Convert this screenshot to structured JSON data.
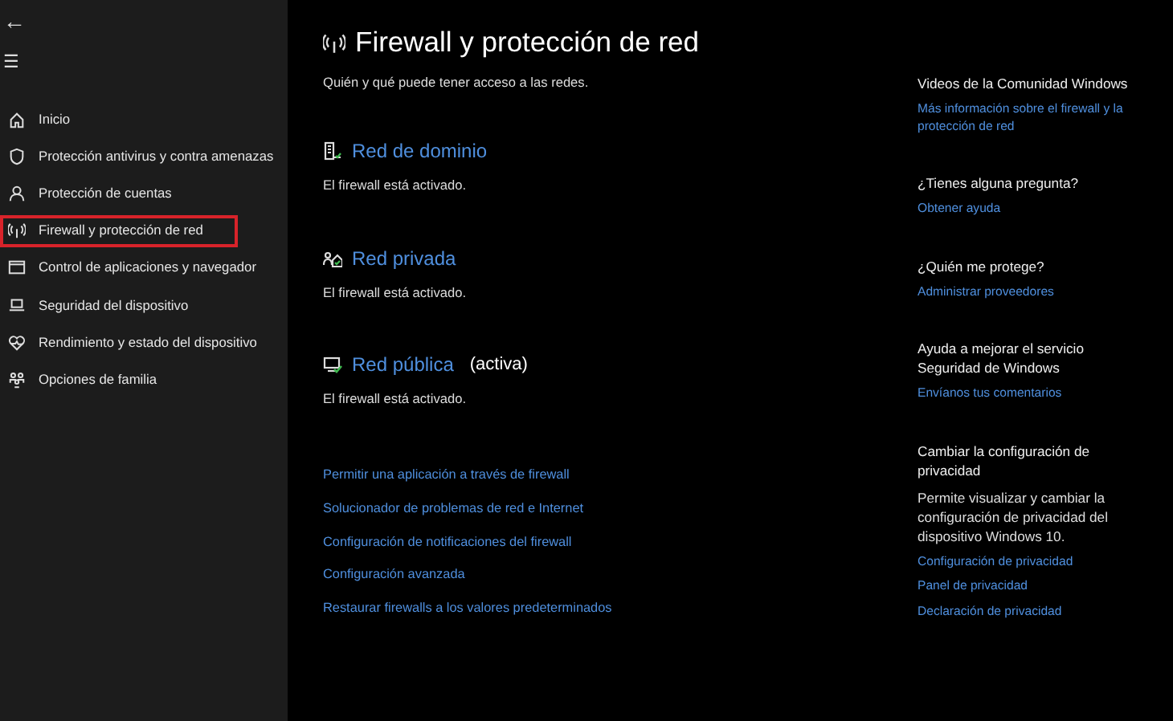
{
  "sidebar": {
    "back": "←",
    "menu": "☰",
    "items": [
      {
        "label": "Inicio",
        "selected": false
      },
      {
        "label": "Protección antivirus y contra amenazas",
        "selected": false
      },
      {
        "label": "Protección de cuentas",
        "selected": false
      },
      {
        "label": "Firewall y protección de red",
        "selected": true
      },
      {
        "label": "Control de aplicaciones y navegador",
        "selected": false
      },
      {
        "label": "Seguridad del dispositivo",
        "selected": false
      },
      {
        "label": "Rendimiento y estado del dispositivo",
        "selected": false
      },
      {
        "label": "Opciones de familia",
        "selected": false
      }
    ]
  },
  "main": {
    "title": "Firewall y protección de red",
    "subtitle": "Quién y qué puede tener acceso a las redes.",
    "networks": [
      {
        "name": "Red de dominio",
        "status": "El firewall está activado."
      },
      {
        "name": "Red privada",
        "status": "El firewall está activado."
      },
      {
        "name": "Red pública",
        "tag": "(activa)",
        "status": "El firewall está activado."
      }
    ],
    "links": [
      "Permitir una aplicación a través de firewall",
      "Solucionador de problemas de red e Internet",
      "Configuración de notificaciones del firewall",
      "Configuración avanzada",
      "Restaurar firewalls a los valores predeterminados"
    ]
  },
  "aside": [
    {
      "heading": "Videos de la Comunidad Windows",
      "links": [
        "Más información sobre el firewall y la protección de red"
      ]
    },
    {
      "heading": "¿Tienes alguna pregunta?",
      "links": [
        "Obtener ayuda"
      ]
    },
    {
      "heading": "¿Quién me protege?",
      "links": [
        "Administrar proveedores"
      ]
    },
    {
      "heading": "Ayuda a mejorar el servicio Seguridad de Windows",
      "links": [
        "Envíanos tus comentarios"
      ]
    },
    {
      "heading": "Cambiar la configuración de privacidad",
      "text": "Permite visualizar y cambiar la configuración de privacidad del dispositivo Windows 10.",
      "links": [
        "Configuración de privacidad",
        "Panel de privacidad",
        "Declaración de privacidad"
      ]
    }
  ]
}
